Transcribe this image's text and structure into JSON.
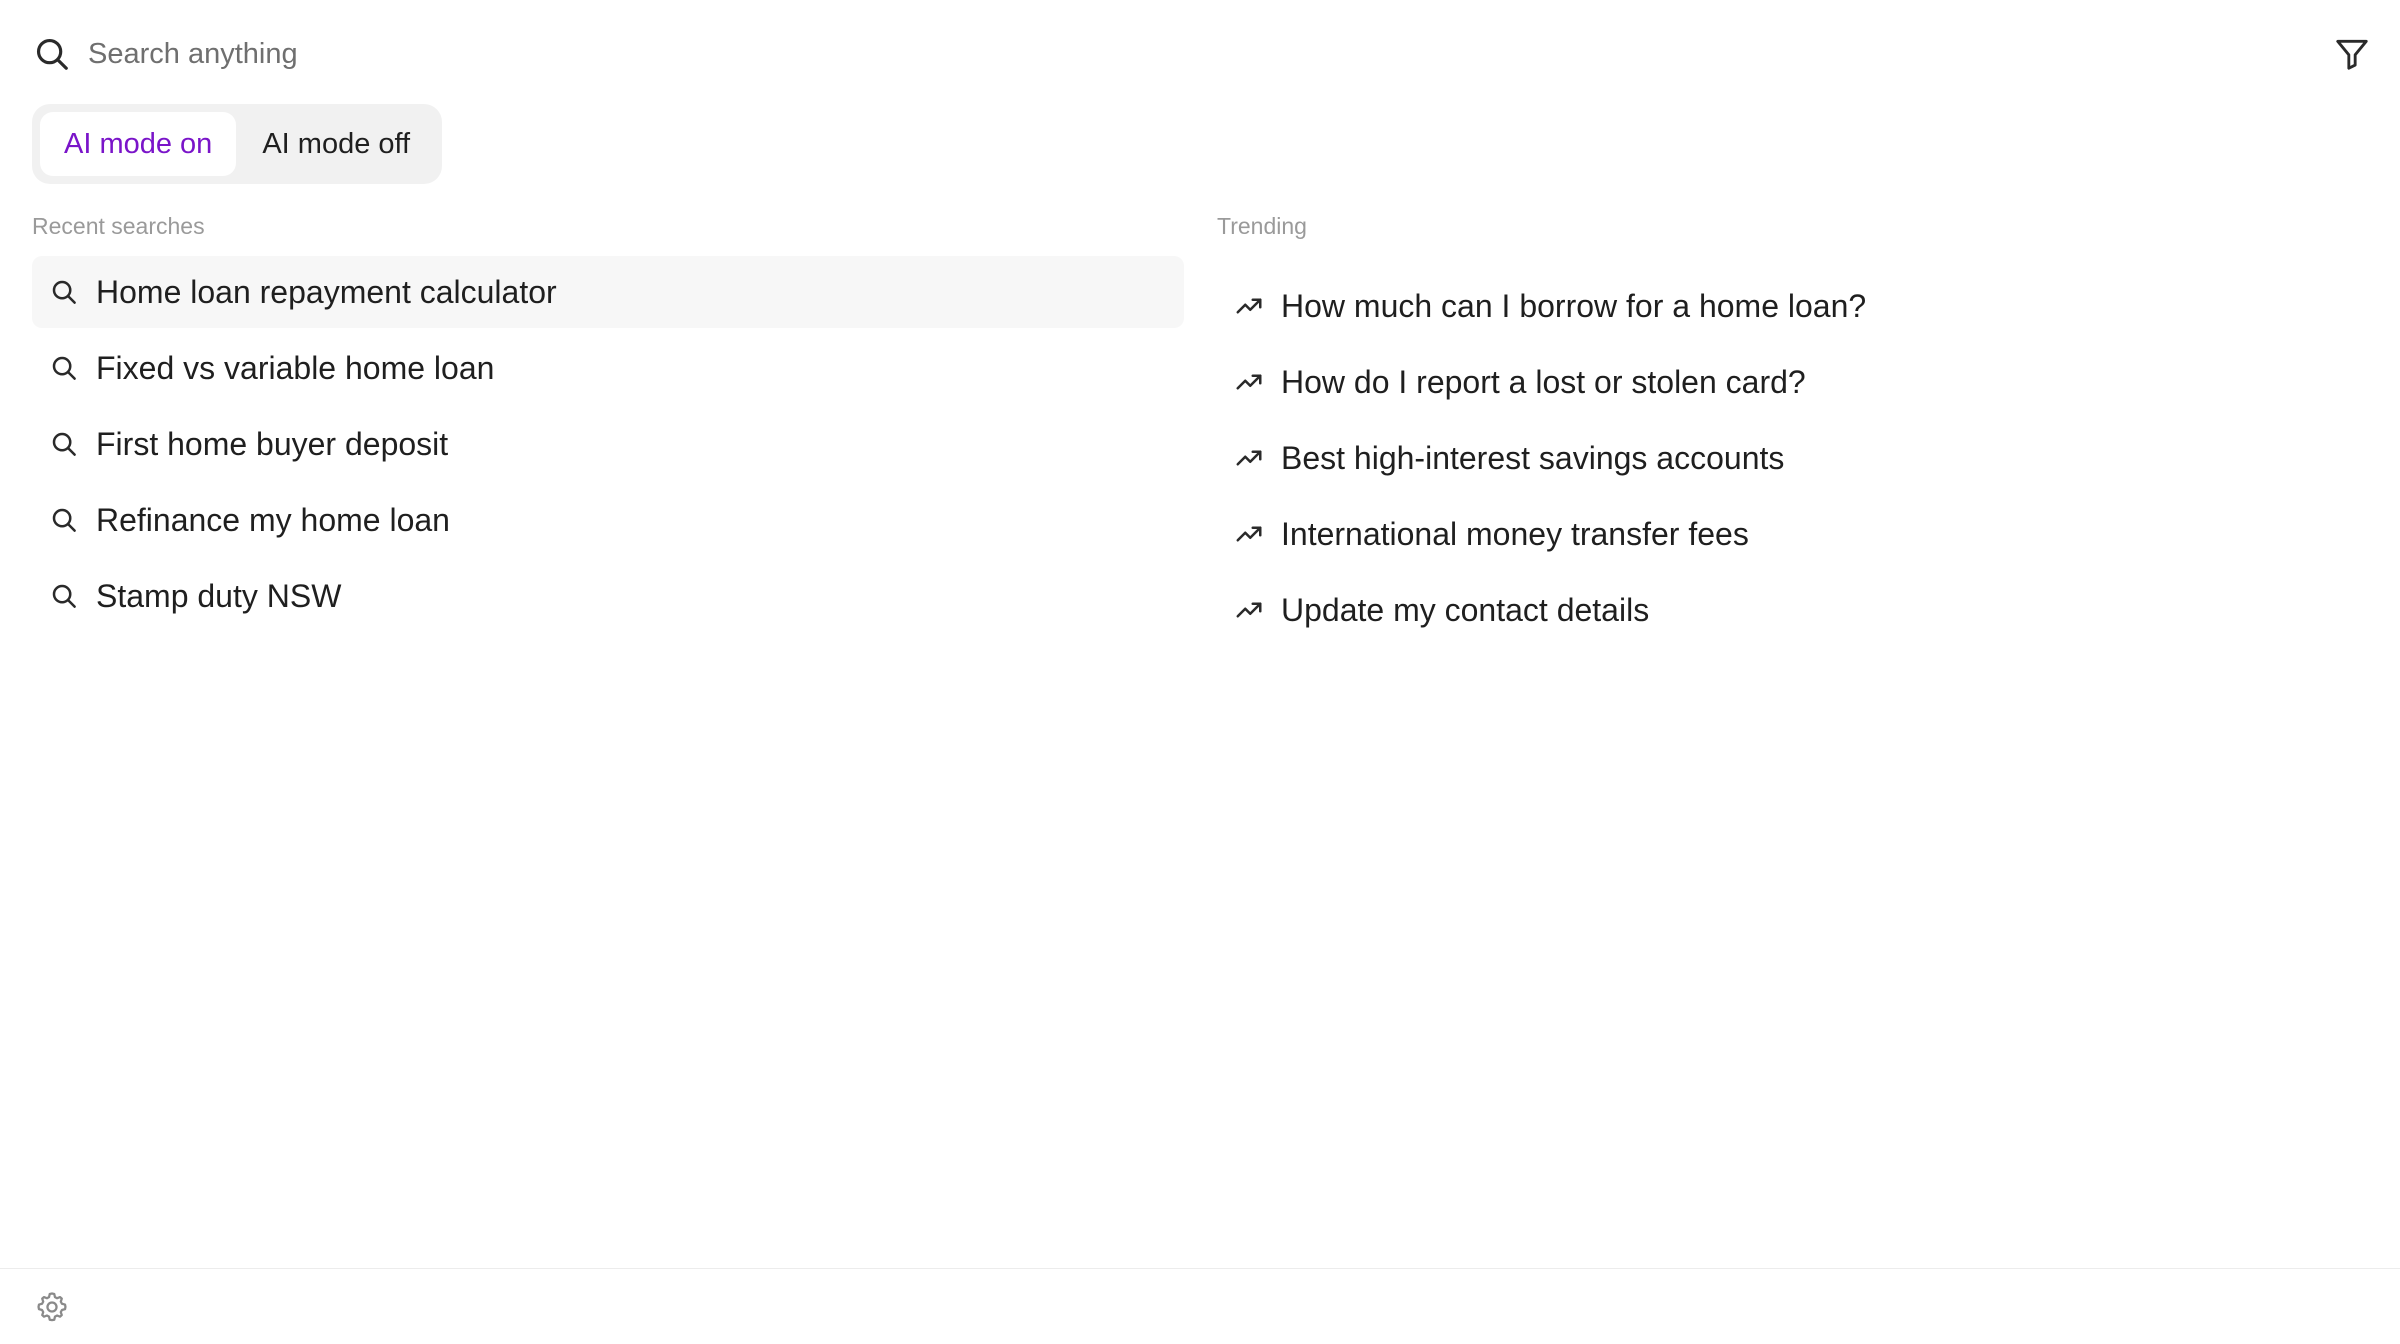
{
  "search": {
    "placeholder": "Search anything",
    "value": "",
    "icon": "search-icon",
    "filter_icon": "filter-icon"
  },
  "mode_toggle": {
    "options": [
      {
        "label": "AI mode on",
        "active": true
      },
      {
        "label": "AI mode off",
        "active": false
      }
    ],
    "active_color": "#7a14c9"
  },
  "recent": {
    "title": "Recent searches",
    "icon": "search-icon",
    "items": [
      {
        "label": "Home loan repayment calculator"
      },
      {
        "label": "Fixed vs variable home loan"
      },
      {
        "label": "First home buyer deposit"
      },
      {
        "label": "Refinance my home loan"
      },
      {
        "label": "Stamp duty NSW"
      }
    ]
  },
  "trending": {
    "title": "Trending",
    "icon": "trending-up-icon",
    "items": [
      {
        "label": "How much can I borrow for a home loan?"
      },
      {
        "label": "How do I report a lost or stolen card?"
      },
      {
        "label": "Best high-interest savings accounts"
      },
      {
        "label": "International money transfer fees"
      },
      {
        "label": "Update my contact details"
      }
    ]
  },
  "footer": {
    "settings_icon": "gear-icon"
  }
}
